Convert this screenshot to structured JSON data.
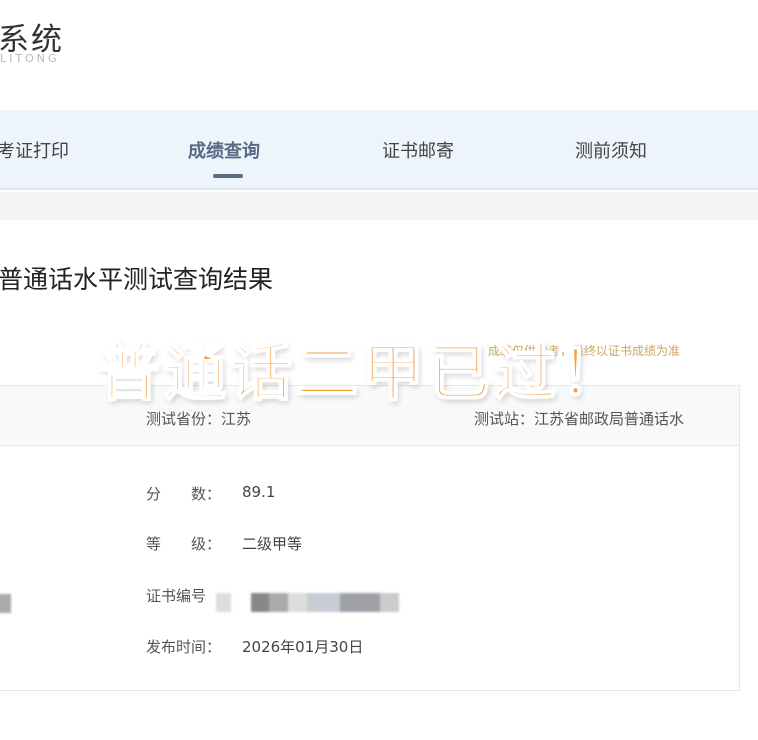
{
  "header": {
    "logo_text": "系统",
    "logo_sub": "LITONG"
  },
  "nav": {
    "items": [
      {
        "label": "考证打印"
      },
      {
        "label": "成绩查询",
        "active": true
      },
      {
        "label": "证书邮寄"
      },
      {
        "label": "测前须知"
      }
    ]
  },
  "page": {
    "title": "普通话水平测试查询结果",
    "notice": "成绩仅供参考，最终以证书成绩为准"
  },
  "result": {
    "province": "测试省份：江苏",
    "station": "测试站：江苏省邮政局普通话水",
    "score_label": "分　　数：",
    "score": "89.1",
    "level_label": "等　　级：",
    "level": "二级甲等",
    "cert_label": "证书编号",
    "date_label": "发布时间：",
    "date": "2026年01月30日"
  },
  "overlay": {
    "text": "普通话二甲已过！",
    "color": "#f6a043"
  }
}
